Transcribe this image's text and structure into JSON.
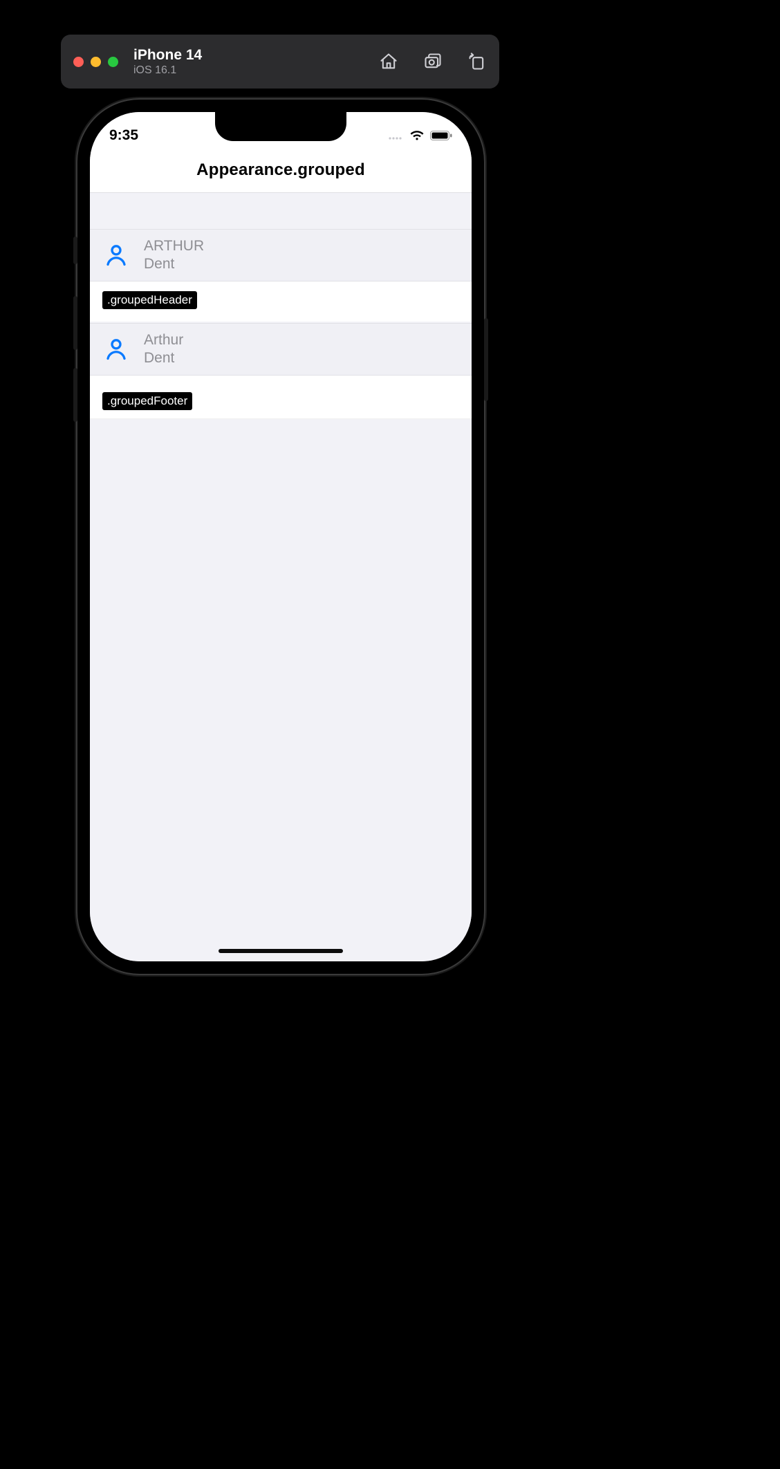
{
  "simulator": {
    "device": "iPhone 14",
    "os": "iOS 16.1"
  },
  "status": {
    "time": "9:35"
  },
  "nav": {
    "title": "Appearance.grouped"
  },
  "cells": [
    {
      "first": "ARTHUR",
      "last": "Dent"
    },
    {
      "first": "Arthur",
      "last": "Dent"
    }
  ],
  "annotations": {
    "header": ".groupedHeader",
    "footer": ".groupedFooter"
  },
  "colors": {
    "accent": "#0a7aff",
    "grouped_bg": "#f2f2f7",
    "secondary_text": "#8e8e93"
  }
}
